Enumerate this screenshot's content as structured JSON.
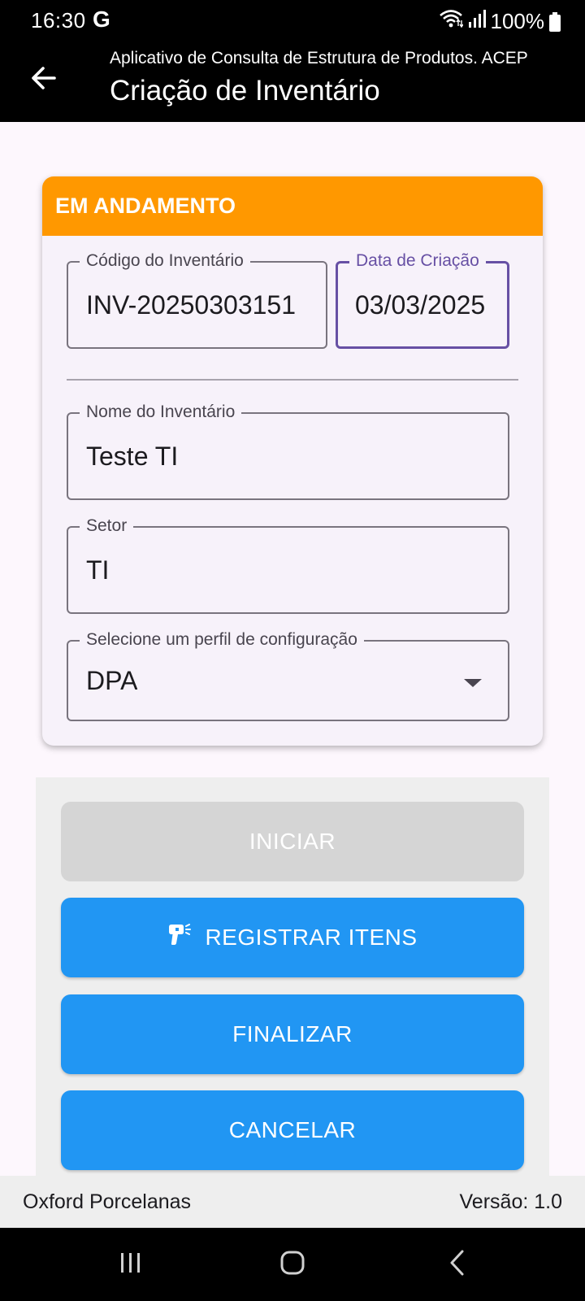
{
  "status_bar": {
    "time": "16:30",
    "google_icon": "G",
    "battery_text": "100%",
    "icons": [
      "wifi-icon",
      "signal-icon",
      "battery-icon"
    ]
  },
  "app_bar": {
    "subtitle": "Aplicativo de Consulta de Estrutura de Produtos. ACEP",
    "title": "Criação de Inventário",
    "back_icon": "arrow-left-icon"
  },
  "card": {
    "status": "EM ANDAMENTO",
    "status_color": "#ff9800",
    "fields": {
      "codigo": {
        "label": "Código do Inventário",
        "value": "INV-20250303151"
      },
      "data": {
        "label": "Data de Criação",
        "value": "03/03/2025"
      },
      "nome": {
        "label": "Nome do Inventário",
        "value": "Teste TI"
      },
      "setor": {
        "label": "Setor",
        "value": "TI"
      },
      "perfil": {
        "label": "Selecione um perfil de configuração",
        "value": "DPA"
      }
    }
  },
  "buttons": {
    "iniciar": "INICIAR",
    "registrar": "REGISTRAR ITENS",
    "finalizar": "FINALIZAR",
    "cancelar": "CANCELAR",
    "primary_color": "#2196f3",
    "disabled_color": "#d5d5d5"
  },
  "footer": {
    "company": "Oxford Porcelanas",
    "version": "Versão: 1.0"
  },
  "nav_bar": {
    "icons": [
      "recents-icon",
      "home-icon",
      "back-icon"
    ]
  }
}
